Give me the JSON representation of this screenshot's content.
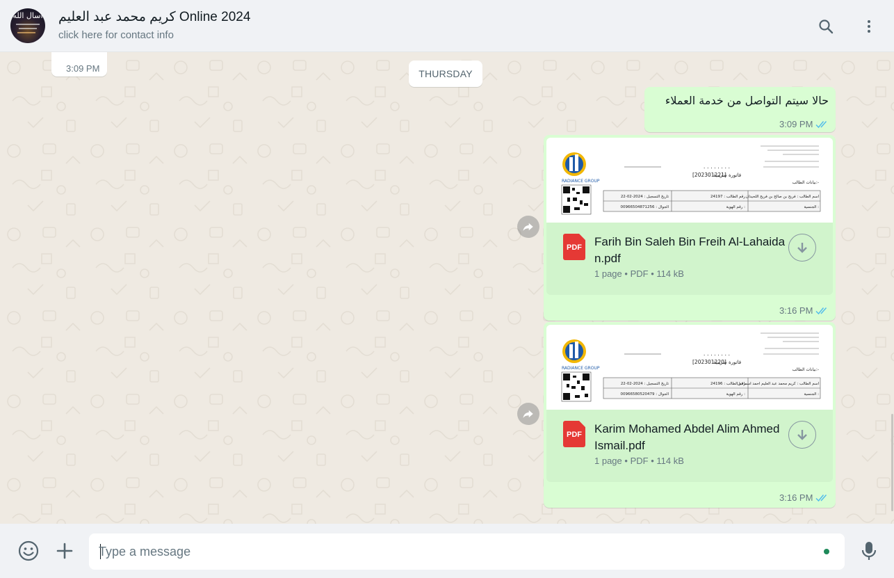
{
  "header": {
    "contact_name": "كريم محمد عبد العليم Online 2024",
    "contact_subtitle": "click here for contact info",
    "avatar_text": "اسال الله",
    "icons": {
      "search": "search-icon",
      "menu": "kebab-menu-icon"
    }
  },
  "chat": {
    "date_separator": "THURSDAY",
    "incoming_partial": {
      "time": "3:09 PM"
    },
    "outgoing_text": {
      "text": "حالا سيتم التواصل من خدمة العملاء",
      "time": "3:09 PM",
      "status": "read-double-check"
    },
    "documents": [
      {
        "file_name": "Farih Bin Saleh Bin Freih Al-Lahaidan.pdf",
        "file_type_label": "PDF",
        "pages": "1 page",
        "type": "PDF",
        "size": "114 kB",
        "time": "3:16 PM",
        "preview": {
          "logo_text": "RADIANCE GROUP",
          "invoice_title": "فاتورة ضريبية",
          "invoice_number": "[202301221]",
          "section_label": "بيانات الطالب:-",
          "student_name_label": "اسم الطالب : فريح بن صالح بن فريح اللحيدان",
          "student_no": "رقم الطالب : 24197",
          "reg_date": "تاريخ التسجيل : 2024-02-22",
          "nationality_label": "الجنسية :",
          "id_label": "رقم الهوية :",
          "mobile": "الجوال : 00966504871256"
        }
      },
      {
        "file_name": "Karim Mohamed Abdel Alim Ahmed Ismail.pdf",
        "file_type_label": "PDF",
        "pages": "1 page",
        "type": "PDF",
        "size": "114 kB",
        "time": "3:16 PM",
        "preview": {
          "logo_text": "RADIANCE GROUP",
          "invoice_title": "فاتورة ضريبية",
          "invoice_number": "[202301220]",
          "section_label": "بيانات الطالب:-",
          "student_name_label": "اسم الطالب : كريم محمد عبد العليم احمد اسماعيل",
          "student_no": "رقم الطالب : 24196",
          "reg_date": "تاريخ التسجيل : 2024-02-22",
          "nationality_label": "الجنسية :",
          "id_label": "رقم الهوية :",
          "mobile": "الجوال : 00966580520479"
        }
      }
    ]
  },
  "footer": {
    "placeholder": "Type a message",
    "icons": {
      "emoji": "emoji-icon",
      "attach": "plus-icon",
      "mic": "microphone-icon"
    }
  },
  "colors": {
    "outgoing_bubble": "#d9fdd3",
    "incoming_bubble": "#ffffff",
    "chat_background": "#efeae2",
    "read_ticks": "#53bdeb",
    "pdf_red": "#e53935"
  }
}
